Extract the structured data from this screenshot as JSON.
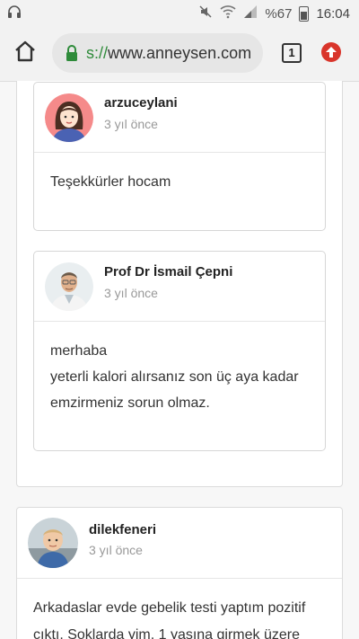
{
  "status_bar": {
    "battery": "%67",
    "time": "16:04"
  },
  "browser": {
    "url_scheme": "s://",
    "url_host": "www.anneysen.com",
    "tab_count": "1"
  },
  "replies": [
    {
      "username": "arzuceylani",
      "time": "3 yıl önce",
      "lines": [
        "Teşekkürler hocam"
      ]
    },
    {
      "username": "Prof Dr İsmail Çepni",
      "time": "3 yıl önce",
      "lines": [
        "merhaba",
        "yeterli kalori alırsanız son üç aya kadar",
        "emzirmeniz sorun olmaz."
      ]
    }
  ],
  "post": {
    "username": "dilekfeneri",
    "time": "3 yıl önce",
    "lines": [
      "Arkadaslar evde gebelik testi yaptım pozitif",
      "çıktı. Şoklarda yim. 1 yaşına girmek üzere"
    ]
  },
  "colors": {
    "accent_green": "#2e8b3a",
    "update_red": "#d9352b"
  }
}
